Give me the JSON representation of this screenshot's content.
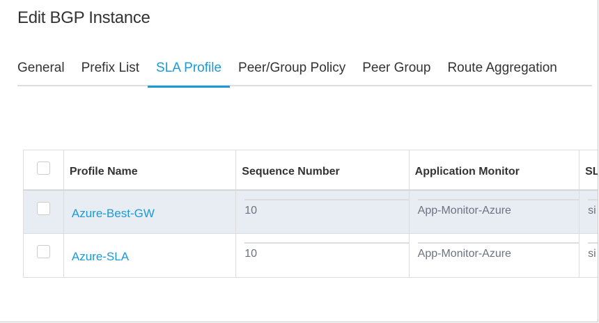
{
  "title": "Edit BGP Instance",
  "tabs": [
    {
      "label": "General"
    },
    {
      "label": "Prefix List"
    },
    {
      "label": "SLA Profile",
      "active": true
    },
    {
      "label": "Peer/Group Policy"
    },
    {
      "label": "Peer Group"
    },
    {
      "label": "Route Aggregation"
    }
  ],
  "table": {
    "headers": [
      "Profile Name",
      "Sequence Number",
      "Application Monitor",
      "SL"
    ],
    "rows": [
      {
        "profile_name": "Azure-Best-GW",
        "sequence_number": "10",
        "application_monitor": "App-Monitor-Azure",
        "sla": "si",
        "selected": true
      },
      {
        "profile_name": "Azure-SLA",
        "sequence_number": "10",
        "application_monitor": "App-Monitor-Azure",
        "sla": "si",
        "selected": false
      }
    ]
  },
  "colors": {
    "accent": "#1a9ad6",
    "selected_row": "#e8edf3"
  }
}
